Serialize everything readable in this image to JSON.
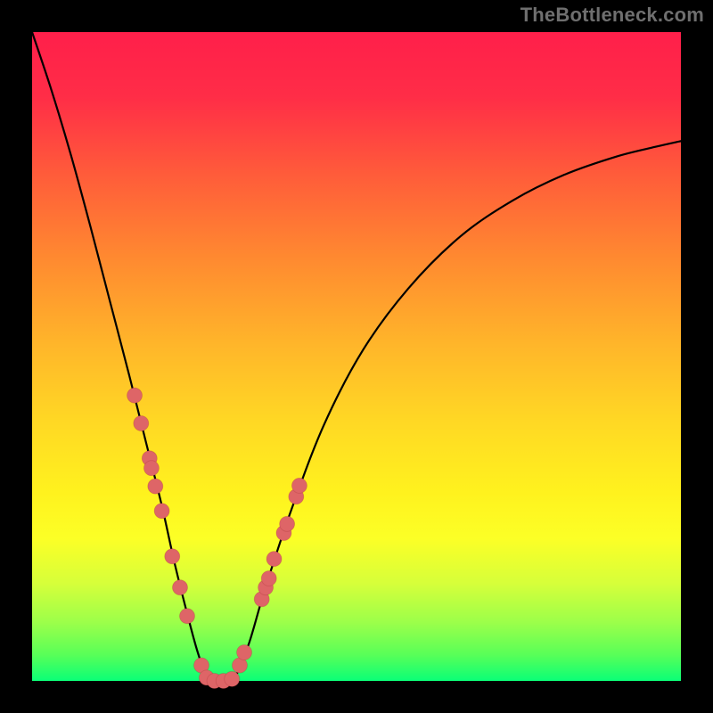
{
  "watermark": "TheBottleneck.com",
  "chart_data": {
    "type": "line",
    "title": "",
    "xlabel": "",
    "ylabel": "",
    "xlim": [
      0,
      1
    ],
    "ylim": [
      0,
      1
    ],
    "series": [
      {
        "name": "curve",
        "points": [
          {
            "x": 0.0,
            "y": 1.0
          },
          {
            "x": 0.03,
            "y": 0.91
          },
          {
            "x": 0.06,
            "y": 0.81
          },
          {
            "x": 0.09,
            "y": 0.7
          },
          {
            "x": 0.12,
            "y": 0.585
          },
          {
            "x": 0.15,
            "y": 0.47
          },
          {
            "x": 0.175,
            "y": 0.37
          },
          {
            "x": 0.2,
            "y": 0.27
          },
          {
            "x": 0.22,
            "y": 0.18
          },
          {
            "x": 0.24,
            "y": 0.1
          },
          {
            "x": 0.255,
            "y": 0.045
          },
          {
            "x": 0.268,
            "y": 0.01
          },
          {
            "x": 0.28,
            "y": 0.0
          },
          {
            "x": 0.3,
            "y": 0.0
          },
          {
            "x": 0.315,
            "y": 0.01
          },
          {
            "x": 0.335,
            "y": 0.06
          },
          {
            "x": 0.36,
            "y": 0.145
          },
          {
            "x": 0.4,
            "y": 0.265
          },
          {
            "x": 0.45,
            "y": 0.395
          },
          {
            "x": 0.51,
            "y": 0.51
          },
          {
            "x": 0.58,
            "y": 0.605
          },
          {
            "x": 0.66,
            "y": 0.685
          },
          {
            "x": 0.74,
            "y": 0.74
          },
          {
            "x": 0.82,
            "y": 0.78
          },
          {
            "x": 0.9,
            "y": 0.808
          },
          {
            "x": 0.96,
            "y": 0.823
          },
          {
            "x": 1.0,
            "y": 0.832
          }
        ]
      }
    ],
    "dots": [
      {
        "x": 0.158,
        "y": 0.44
      },
      {
        "x": 0.168,
        "y": 0.397
      },
      {
        "x": 0.181,
        "y": 0.343
      },
      {
        "x": 0.184,
        "y": 0.328
      },
      {
        "x": 0.19,
        "y": 0.3
      },
      {
        "x": 0.2,
        "y": 0.262
      },
      {
        "x": 0.216,
        "y": 0.192
      },
      {
        "x": 0.228,
        "y": 0.144
      },
      {
        "x": 0.239,
        "y": 0.1
      },
      {
        "x": 0.261,
        "y": 0.024
      },
      {
        "x": 0.269,
        "y": 0.005
      },
      {
        "x": 0.281,
        "y": 0.0
      },
      {
        "x": 0.295,
        "y": 0.0
      },
      {
        "x": 0.308,
        "y": 0.003
      },
      {
        "x": 0.32,
        "y": 0.024
      },
      {
        "x": 0.327,
        "y": 0.044
      },
      {
        "x": 0.354,
        "y": 0.126
      },
      {
        "x": 0.36,
        "y": 0.144
      },
      {
        "x": 0.365,
        "y": 0.158
      },
      {
        "x": 0.373,
        "y": 0.188
      },
      {
        "x": 0.388,
        "y": 0.228
      },
      {
        "x": 0.393,
        "y": 0.242
      },
      {
        "x": 0.407,
        "y": 0.284
      },
      {
        "x": 0.412,
        "y": 0.301
      }
    ],
    "dot_radius": 8.5
  }
}
